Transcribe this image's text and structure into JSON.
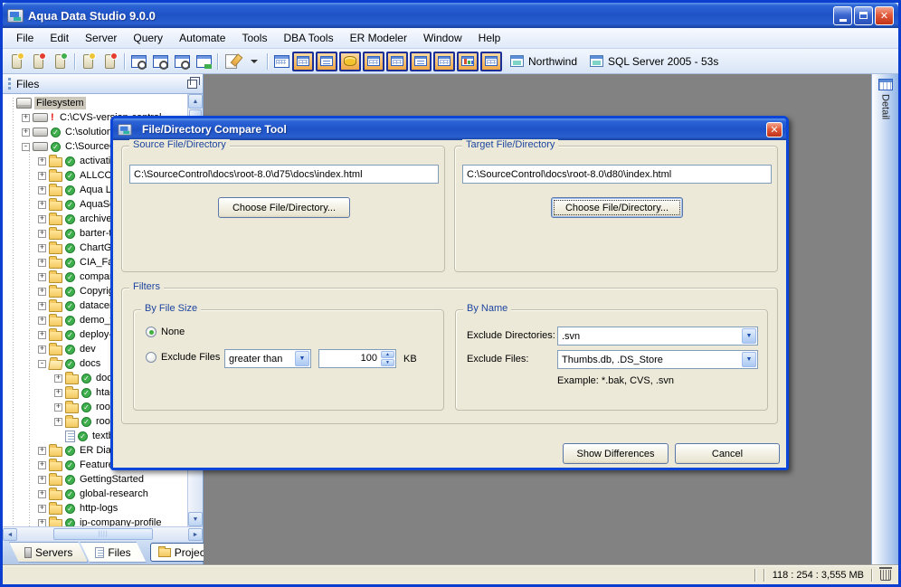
{
  "window": {
    "title": "Aqua Data Studio 9.0.0"
  },
  "menubar": {
    "items": [
      "File",
      "Edit",
      "Server",
      "Query",
      "Automate",
      "Tools",
      "DBA Tools",
      "ER Modeler",
      "Window",
      "Help"
    ]
  },
  "toolbar": {
    "items": [
      {
        "t": "icon",
        "name": "register-server-icon",
        "v": "srv",
        "badge": "gold"
      },
      {
        "t": "icon",
        "name": "remove-server-icon",
        "v": "srv",
        "badge": "red"
      },
      {
        "t": "icon",
        "name": "schema-objects-icon",
        "v": "srv",
        "badge": "green"
      },
      {
        "t": "sep"
      },
      {
        "t": "icon",
        "name": "connect-server-icon",
        "v": "srv",
        "badge": "gold"
      },
      {
        "t": "icon",
        "name": "disconnect-server-icon",
        "v": "srv",
        "badge": "red"
      },
      {
        "t": "sep"
      },
      {
        "t": "icon",
        "name": "query-analyzer-icon",
        "v": "win mag"
      },
      {
        "t": "icon",
        "name": "query-window-icon",
        "v": "win mag"
      },
      {
        "t": "icon",
        "name": "query-builder-icon",
        "v": "win mag"
      },
      {
        "t": "icon",
        "name": "import-export-icon",
        "v": "win arrow"
      },
      {
        "t": "sep"
      },
      {
        "t": "icon",
        "name": "open-script-icon",
        "v": "doc"
      },
      {
        "t": "icon",
        "name": "script-dropdown-icon",
        "v": "dd"
      },
      {
        "t": "sep"
      },
      {
        "t": "icon",
        "name": "schema-browser-icon",
        "v": "win grid2"
      }
    ],
    "highlight_items": [
      {
        "name": "table-data-icon",
        "v": "v-grid"
      },
      {
        "name": "form-view-icon",
        "v": "v-form"
      },
      {
        "name": "database-icon",
        "v": "v-db"
      },
      {
        "name": "grid-view-icon",
        "v": "v-grid"
      },
      {
        "name": "pivot-view-icon",
        "v": "v-pivot"
      },
      {
        "name": "list-view-icon",
        "v": "v-list"
      },
      {
        "name": "er-diagram-icon",
        "v": "v-tree"
      },
      {
        "name": "chart-icon",
        "v": "v-chart"
      },
      {
        "name": "table-view-icon",
        "v": "v-grid"
      }
    ],
    "context_items": [
      {
        "name": "database-selector",
        "label": "Northwind"
      },
      {
        "name": "server-selector",
        "label": "SQL Server 2005 - 53s"
      }
    ]
  },
  "files_panel": {
    "title": "Files",
    "tree": [
      {
        "label": "Filesystem",
        "level": 0,
        "type": "root",
        "badge": "",
        "expand": "",
        "selected": true
      },
      {
        "label": "C:\\CVS-version-control",
        "level": 1,
        "type": "drive",
        "badge": "error",
        "expand": "+"
      },
      {
        "label": "C:\\solution-e",
        "level": 1,
        "type": "drive",
        "badge": "ok",
        "expand": "+"
      },
      {
        "label": "C:\\SourceCon",
        "level": 1,
        "type": "drive",
        "badge": "ok",
        "expand": "-"
      },
      {
        "label": "activation",
        "level": 2,
        "type": "folder",
        "badge": "ok",
        "expand": "+"
      },
      {
        "label": "ALLCORP",
        "level": 2,
        "type": "folder",
        "badge": "ok",
        "expand": "+"
      },
      {
        "label": "Aqua Lice",
        "level": 2,
        "type": "folder",
        "badge": "ok",
        "expand": "+"
      },
      {
        "label": "AquaScrip",
        "level": 2,
        "type": "folder",
        "badge": "ok",
        "expand": "+"
      },
      {
        "label": "archive-s",
        "level": 2,
        "type": "folder",
        "badge": "ok",
        "expand": "+"
      },
      {
        "label": "barter-ta",
        "level": 2,
        "type": "folder",
        "badge": "ok",
        "expand": "+"
      },
      {
        "label": "ChartGall",
        "level": 2,
        "type": "folder",
        "badge": "ok",
        "expand": "+"
      },
      {
        "label": "CIA_Fact",
        "level": 2,
        "type": "folder",
        "badge": "ok",
        "expand": "+"
      },
      {
        "label": "companys",
        "level": 2,
        "type": "folder",
        "badge": "ok",
        "expand": "+"
      },
      {
        "label": "Copyrigh",
        "level": 2,
        "type": "folder",
        "badge": "ok",
        "expand": "+"
      },
      {
        "label": "datacent",
        "level": 2,
        "type": "folder",
        "badge": "ok",
        "expand": "+"
      },
      {
        "label": "demo_wo",
        "level": 2,
        "type": "folder",
        "badge": "ok",
        "expand": "+"
      },
      {
        "label": "deploy-re",
        "level": 2,
        "type": "folder",
        "badge": "ok",
        "expand": "+"
      },
      {
        "label": "dev",
        "level": 2,
        "type": "folder",
        "badge": "ok",
        "expand": "+"
      },
      {
        "label": "docs",
        "level": 2,
        "type": "folder-open",
        "badge": "ok",
        "expand": "-"
      },
      {
        "label": "docs-",
        "level": 3,
        "type": "folder",
        "badge": "ok",
        "expand": "+"
      },
      {
        "label": "htaco",
        "level": 3,
        "type": "folder",
        "badge": "ok",
        "expand": "+"
      },
      {
        "label": "root-",
        "level": 3,
        "type": "folder",
        "badge": "ok",
        "expand": "+"
      },
      {
        "label": "root-",
        "level": 3,
        "type": "folder",
        "badge": "ok",
        "expand": "+"
      },
      {
        "label": "textb",
        "level": 3,
        "type": "file",
        "badge": "ok",
        "expand": ""
      },
      {
        "label": "ER Diagra",
        "level": 2,
        "type": "folder",
        "badge": "ok",
        "expand": "+"
      },
      {
        "label": "Features",
        "level": 2,
        "type": "folder",
        "badge": "ok",
        "expand": "+"
      },
      {
        "label": "GettingStarted",
        "level": 2,
        "type": "folder",
        "badge": "ok",
        "expand": "+"
      },
      {
        "label": "global-research",
        "level": 2,
        "type": "folder",
        "badge": "ok",
        "expand": "+"
      },
      {
        "label": "http-logs",
        "level": 2,
        "type": "folder",
        "badge": "ok",
        "expand": "+"
      },
      {
        "label": "ip-company-profile",
        "level": 2,
        "type": "folder",
        "badge": "ok",
        "expand": "+"
      }
    ]
  },
  "bottom_tabs": [
    {
      "label": "Servers",
      "active": false,
      "boxed": false
    },
    {
      "label": "Files",
      "active": true,
      "boxed": false
    },
    {
      "label": "Projects",
      "active": false,
      "boxed": true
    }
  ],
  "right_panel": {
    "tab_label": "Detail"
  },
  "statusbar": {
    "stats": "118 : 254 : 3,555 MB"
  },
  "dialog": {
    "title": "File/Directory Compare Tool",
    "source": {
      "label": "Source File/Directory",
      "path": "C:\\SourceControl\\docs\\root-8.0\\d75\\docs\\index.html",
      "choose_label": "Choose File/Directory..."
    },
    "target": {
      "label": "Target File/Directory",
      "path": "C:\\SourceControl\\docs\\root-8.0\\d80\\index.html",
      "choose_label": "Choose File/Directory..."
    },
    "filters": {
      "label": "Filters",
      "by_file_size": {
        "label": "By File Size",
        "none_label": "None",
        "exclude_label": "Exclude Files",
        "comparator": "greater than",
        "size_value": "100",
        "unit": "KB"
      },
      "by_name": {
        "label": "By Name",
        "exclude_dirs_label": "Exclude Directories:",
        "exclude_dirs_value": ".svn",
        "exclude_files_label": "Exclude Files:",
        "exclude_files_value": "Thumbs.db, .DS_Store",
        "example": "Example: *.bak, CVS, .svn"
      }
    },
    "buttons": {
      "show_differences": "Show Differences",
      "cancel": "Cancel"
    }
  }
}
